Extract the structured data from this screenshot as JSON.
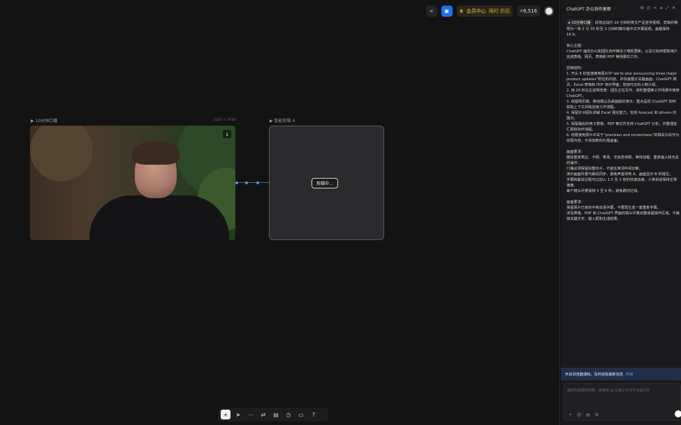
{
  "topbar": {
    "member_label": "会员中心",
    "member_sub": "限时 折扣",
    "credits": "6,516"
  },
  "video_node": {
    "title": "10分钟口播",
    "meta": "1920 × 1080"
  },
  "smart_node": {
    "title": "智能剪辑 4",
    "status": "剪辑中..."
  },
  "panel": {
    "title": "ChatGPT 办公协作更新",
    "chip": "10分钟口播",
    "paragraphs": [
      "请将这段约 10 分钟的英文产品宣传视频，剪辑并精简为一条 2 分 30 秒至 3 分钟的精华版中文字幕视频，画幅保持 16:9。",
      "核心主题：\nChatGPT 面向办公和团队协作推出了哪些更新，以及它如何帮助用户完成表格、网页、表格和 PDF 等场景的工作。",
      "剪辑结构：\n1. 开头 8 秒直接使用原片中“we're also announcing three major product updates”附近的内容，并快速展示关键画面，ChatGPT 网页、Excel 表格和 PDF 演示界面，剪掉冗长的人物介绍。\n2. 用 20 秒左右说明背景：团队正在写作、资料整理等工作场景中使用 ChatGPT。\n3. 保留网页端、移动端以及桌面版的演示，重点呈现 ChatGPT 如何获取上下文并跨应用工作流程。\n4. 保留针对团队讲解 Excel 强化能力，包括 forecast 和 drivers 的展示。\n5. 保留最后的电子表格、PDF 等文件支持 ChatGPT 分析，并整理进汇报和协作流程。\n6. 结尾使用原片中关于“precision and correctness”的相关片段作为收尾内容，不添加新的片尾画面。",
      "画面要求：\n删除重复表达、卡顿、笑场、无信息停顿、等待加载、重复输入和无关的操作。\n口播必须保留完整句子，不能在单词中间切断。\n演示画面尽量与解说同步，避免声音讲到 A、画面显示 B 的错位。\n字幕和解说过程可以加入 1.5 至 2 倍的快速加速，人物讲话保持正常速度。\n每个镜头尽量保持 3 至 6 秒，避免跳切过快。",
      "画面要求：\n保留原片已有的中英双语字幕，不要再生成一套重复字幕。\n涉及表格、PDF 和 ChatGPT 界面的镜头尽量完整保留操作区域，不裁掉关键文字、输入框和生成结果。"
    ],
    "notice_text": "开启浏览器通知，及时获取最新消息",
    "notice_link": "开启",
    "input_placeholder": "描述你想要的效果，或使用 @ 引用工作流节点或文件"
  },
  "icons": {
    "share": "share-icon",
    "layout": "layout-icon",
    "download": "download-icon"
  }
}
